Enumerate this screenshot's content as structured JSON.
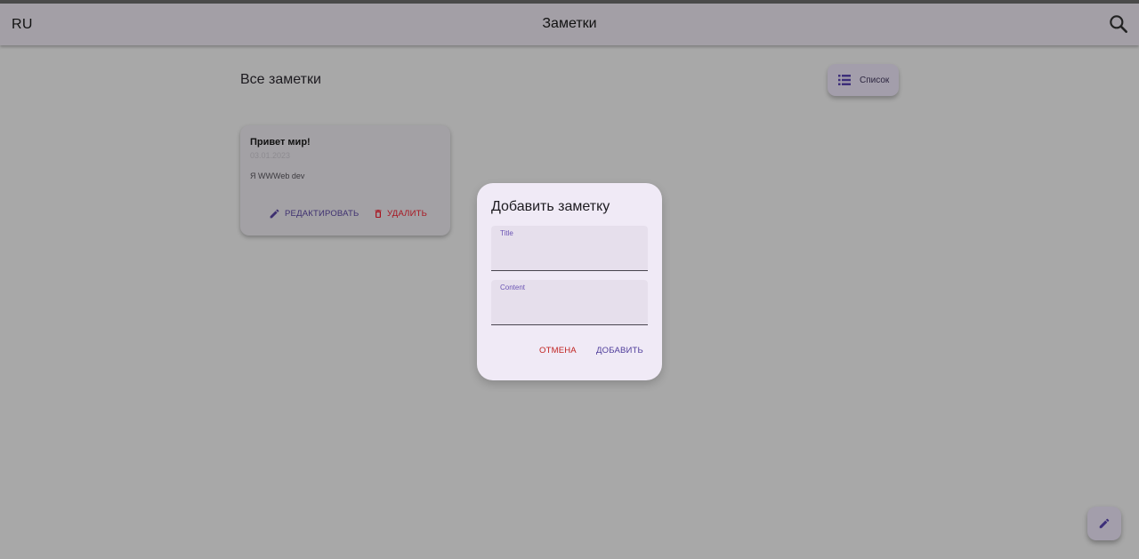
{
  "app_bar": {
    "language": "RU",
    "title": "Заметки",
    "search_icon": "search-icon"
  },
  "header": {
    "section_title": "Все заметки",
    "view_toggle_label": "Список",
    "view_toggle_icon": "list-icon"
  },
  "notes": [
    {
      "title": "Привет мир!",
      "date": "03.01.2023",
      "content": "Я WWWeb dev",
      "edit_label": "РЕДАКТИРОВАТЬ",
      "delete_label": "УДАЛИТЬ",
      "edit_icon": "pencil-icon",
      "delete_icon": "trash-icon"
    }
  ],
  "dialog": {
    "title": "Добавить заметку",
    "title_field_label": "Title",
    "title_field_value": "",
    "content_field_label": "Content",
    "content_field_value": "",
    "cancel_label": "ОТМЕНА",
    "add_label": "ДОБАВИТЬ"
  },
  "fab": {
    "icon": "pencil-icon"
  },
  "colors": {
    "accent": "#4e3c9a",
    "danger": "#c0221f",
    "dialog_bg": "#f0eaf6"
  }
}
